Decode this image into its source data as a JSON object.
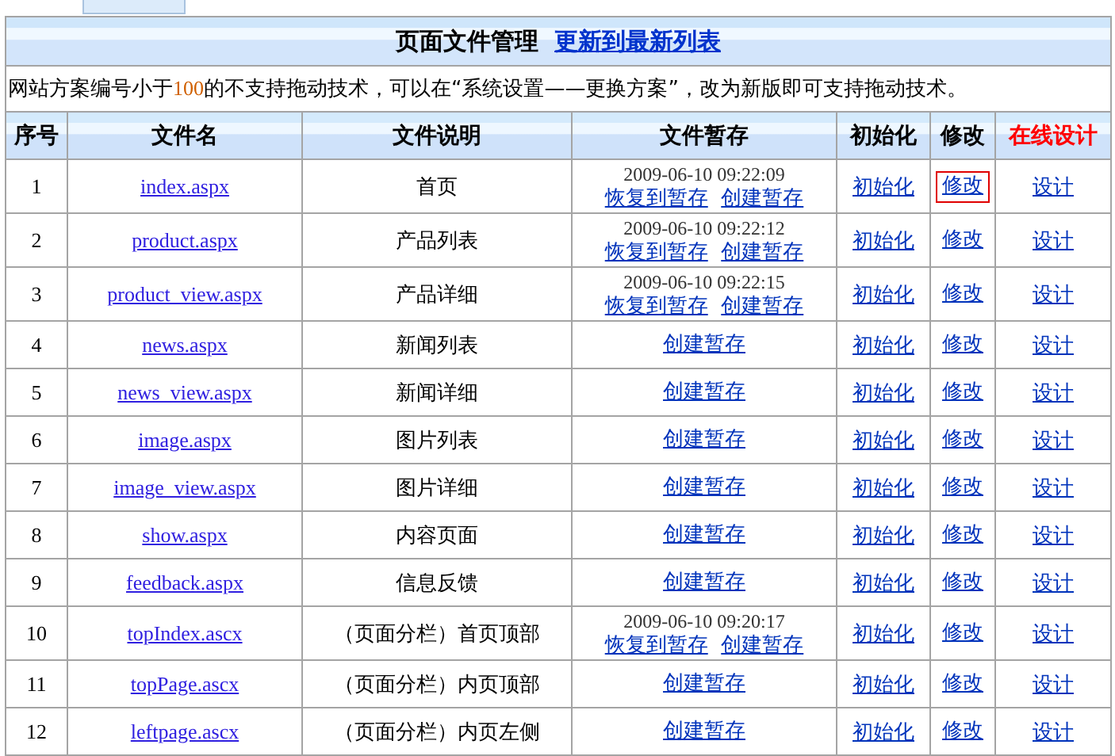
{
  "title": "页面文件管理",
  "refresh_link": "更新到最新列表",
  "notice": [
    {
      "kind": "plain",
      "text": "网站方案编号小于"
    },
    {
      "kind": "number",
      "text": "100"
    },
    {
      "kind": "plain",
      "text": "的不支持拖动技术，可以在“系统设置——更换方案”，改为新版即可支持拖动技术。"
    }
  ],
  "columns": [
    {
      "label": "序号",
      "color": "#000000"
    },
    {
      "label": "文件名",
      "color": "#000000"
    },
    {
      "label": "文件说明",
      "color": "#000000"
    },
    {
      "label": "文件暂存",
      "color": "#000000"
    },
    {
      "label": "初始化",
      "color": "#000000"
    },
    {
      "label": "修改",
      "color": "#000000"
    },
    {
      "label": "在线设计",
      "color": "#ff0000"
    }
  ],
  "rows": [
    {
      "number": "1",
      "file": "index.aspx",
      "description": "首页",
      "saved_time": "2009-06-10 09:22:09",
      "restore": "恢复到暂存",
      "create": "创建暂存",
      "init": "初始化",
      "edit": "修改",
      "edit_focused": true,
      "design": "设计"
    },
    {
      "number": "2",
      "file": "product.aspx",
      "description": "产品列表",
      "saved_time": "2009-06-10 09:22:12",
      "restore": "恢复到暂存",
      "create": "创建暂存",
      "init": "初始化",
      "edit": "修改",
      "edit_focused": false,
      "design": "设计"
    },
    {
      "number": "3",
      "file": "product_view.aspx",
      "description": "产品详细",
      "saved_time": "2009-06-10 09:22:15",
      "restore": "恢复到暂存",
      "create": "创建暂存",
      "init": "初始化",
      "edit": "修改",
      "edit_focused": false,
      "design": "设计"
    },
    {
      "number": "4",
      "file": "news.aspx",
      "description": "新闻列表",
      "create": "创建暂存",
      "init": "初始化",
      "edit": "修改",
      "edit_focused": false,
      "design": "设计"
    },
    {
      "number": "5",
      "file": "news_view.aspx",
      "description": "新闻详细",
      "create": "创建暂存",
      "init": "初始化",
      "edit": "修改",
      "edit_focused": false,
      "design": "设计"
    },
    {
      "number": "6",
      "file": "image.aspx",
      "description": "图片列表",
      "create": "创建暂存",
      "init": "初始化",
      "edit": "修改",
      "edit_focused": false,
      "design": "设计"
    },
    {
      "number": "7",
      "file": "image_view.aspx",
      "description": "图片详细",
      "create": "创建暂存",
      "init": "初始化",
      "edit": "修改",
      "edit_focused": false,
      "design": "设计"
    },
    {
      "number": "8",
      "file": "show.aspx",
      "description": "内容页面",
      "create": "创建暂存",
      "init": "初始化",
      "edit": "修改",
      "edit_focused": false,
      "design": "设计"
    },
    {
      "number": "9",
      "file": "feedback.aspx",
      "description": "信息反馈",
      "create": "创建暂存",
      "init": "初始化",
      "edit": "修改",
      "edit_focused": false,
      "design": "设计"
    },
    {
      "number": "10",
      "file": "topIndex.ascx",
      "description": "（页面分栏）首页顶部",
      "saved_time": "2009-06-10 09:20:17",
      "restore": "恢复到暂存",
      "create": "创建暂存",
      "init": "初始化",
      "edit": "修改",
      "edit_focused": false,
      "design": "设计"
    },
    {
      "number": "11",
      "file": "topPage.ascx",
      "description": "（页面分栏）内页顶部",
      "create": "创建暂存",
      "init": "初始化",
      "edit": "修改",
      "edit_focused": false,
      "design": "设计"
    },
    {
      "number": "12",
      "file": "leftpage.ascx",
      "description": "（页面分栏）内页左侧",
      "create": "创建暂存",
      "init": "初始化",
      "edit": "修改",
      "edit_focused": false,
      "design": "设计"
    }
  ]
}
